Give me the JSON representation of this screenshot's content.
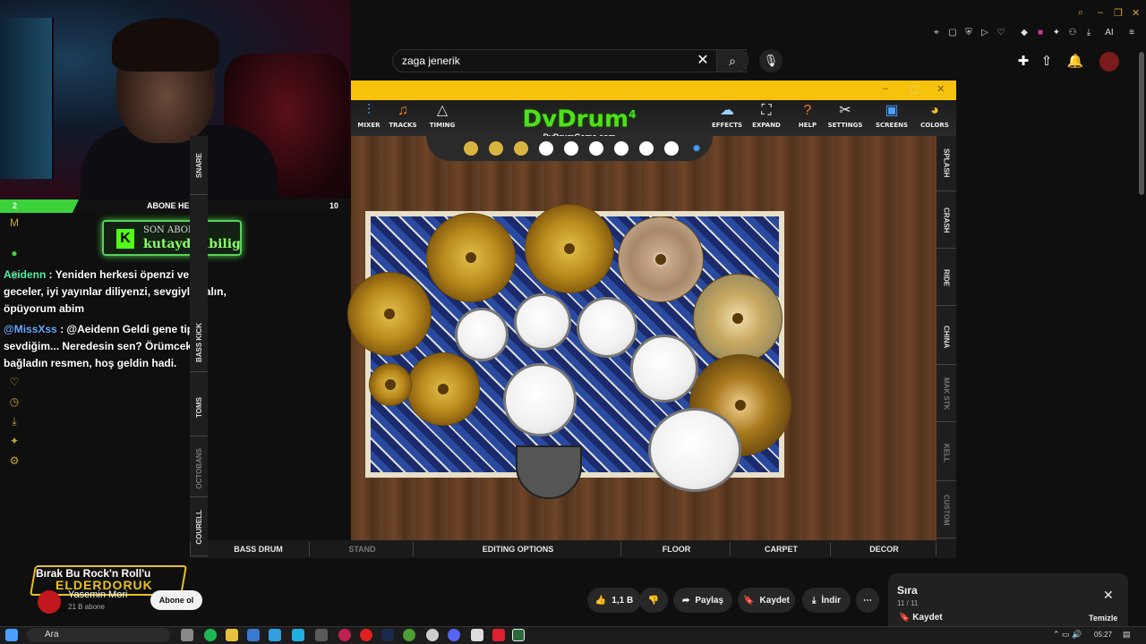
{
  "overlay": {
    "goal_current": "2",
    "goal_label": "ABONE HEDEF",
    "goal_target": "10",
    "goal_progress": 0.2,
    "last_sub_label": "SON ABONE",
    "last_sub_name": "kutaydgubilig",
    "kick_logo_letter": "K"
  },
  "chat": [
    {
      "user": "Aeidenn",
      "text": " : Yeniden herkesi öpenzi ve iyi geceler, iyi yayınlar diliyenzi, sevgiyle kalın, öpüyorum abim"
    },
    {
      "user": "@MissXss",
      "text": " : @Aeidenn Geldi gene tipini sevdiğim... Neredesin sen? Örümcek bağladın resmen, hoş geldin hadi."
    }
  ],
  "search": {
    "value": "zaga jenerik"
  },
  "dvdrum": {
    "logo": "DvDrum",
    "logo_version": "4",
    "logo_url": "DvDrumGame.com",
    "toolbar_left": [
      "MIXER",
      "TRACKS",
      "TIMING"
    ],
    "toolbar_right": [
      "EFFECTS",
      "EXPAND",
      "HELP",
      "SETTINGS",
      "SCREENS",
      "COLORS"
    ],
    "right_tabs": [
      "SPLASH",
      "CRASH",
      "RIDE",
      "CHINA",
      "MAK STK",
      "KELL",
      "CUSTOM"
    ],
    "left_tabs": [
      "COURELL",
      "OCTOBANS",
      "TOMS",
      "BASS KICK",
      "SNARE"
    ],
    "bottom_tabs": [
      "BASS DRUM",
      "STAND",
      "EDITING OPTIONS",
      "FLOOR",
      "CARPET",
      "DECOR"
    ]
  },
  "video": {
    "song_title": "Bırak Bu Rock'n Roll'u",
    "brand": "ELDERDORUK",
    "channel_name": "Yasemin Mori",
    "subs": "21 B abone",
    "subscribe_label": "Abone ol",
    "likes": "1,1 B",
    "share_label": "Paylaş",
    "save_label": "Kaydet",
    "download_label": "İndir"
  },
  "queue": {
    "title": "Sıra",
    "position": "11 / 11",
    "save_label": "Kaydet",
    "clear_label": "Temizle"
  },
  "taskbar": {
    "search_placeholder": "Ara",
    "time": "05:27"
  },
  "colors": {
    "accent": "#f6c20c",
    "dv_green": "#4ee01a",
    "kick_green": "#53fc18"
  }
}
